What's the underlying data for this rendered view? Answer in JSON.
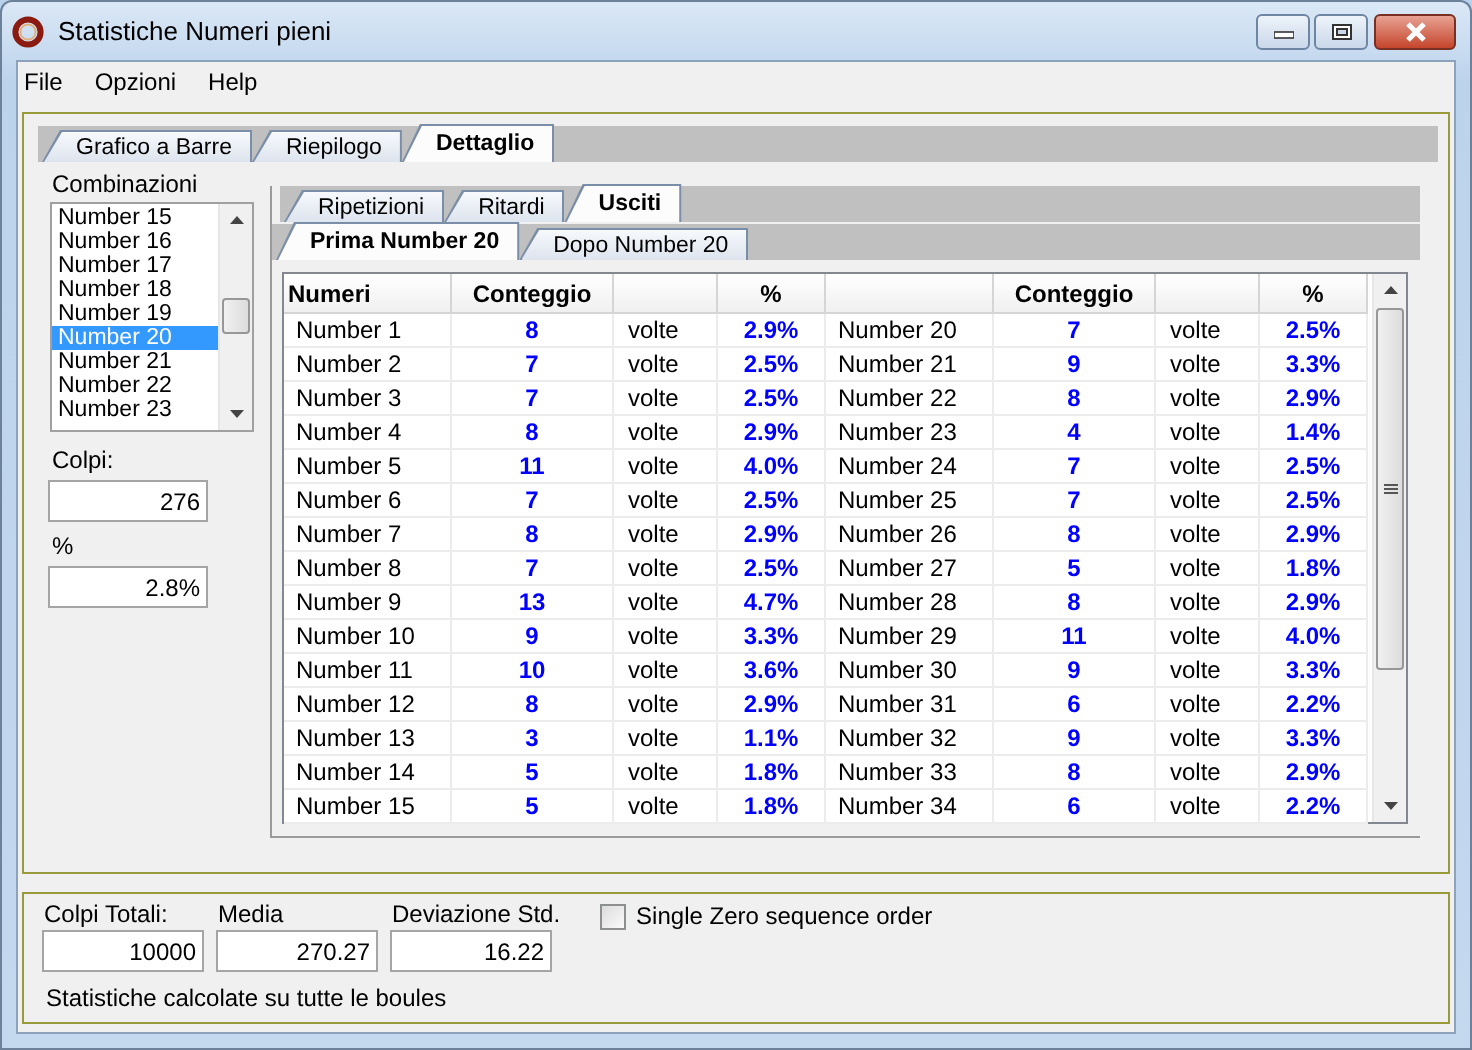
{
  "window": {
    "title": "Statistiche Numeri pieni"
  },
  "menu": [
    "File",
    "Opzioni",
    "Help"
  ],
  "tabs": [
    {
      "label": "Grafico a Barre",
      "selected": false
    },
    {
      "label": "Riepilogo",
      "selected": false
    },
    {
      "label": "Dettaglio",
      "selected": true
    }
  ],
  "combinazioni": {
    "label": "Combinazioni",
    "items": [
      {
        "label": "Number 15",
        "selected": false
      },
      {
        "label": "Number 16",
        "selected": false
      },
      {
        "label": "Number 17",
        "selected": false
      },
      {
        "label": "Number 18",
        "selected": false
      },
      {
        "label": "Number 19",
        "selected": false
      },
      {
        "label": "Number 20",
        "selected": true
      },
      {
        "label": "Number 21",
        "selected": false
      },
      {
        "label": "Number 22",
        "selected": false
      },
      {
        "label": "Number 23",
        "selected": false
      }
    ]
  },
  "colpi": {
    "label": "Colpi:",
    "value": "276"
  },
  "percent": {
    "label": "%",
    "value": "2.8%"
  },
  "sub_tabs": [
    {
      "label": "Ripetizioni",
      "selected": false
    },
    {
      "label": "Ritardi",
      "selected": false
    },
    {
      "label": "Usciti",
      "selected": true
    }
  ],
  "section_tabs": [
    {
      "label": "Prima Number 20",
      "selected": true
    },
    {
      "label": "Dopo Number 20",
      "selected": false
    }
  ],
  "table": {
    "columns": [
      {
        "kind": "name",
        "label": "Numeri"
      },
      {
        "kind": "count",
        "label": "Conteggio"
      },
      {
        "kind": "unit"
      },
      {
        "kind": "percent",
        "label": "%"
      },
      {
        "kind": "name"
      },
      {
        "kind": "count",
        "label": "Conteggio"
      },
      {
        "kind": "unit"
      },
      {
        "kind": "percent",
        "label": "%"
      }
    ],
    "rows": [
      [
        "Number 1",
        "8",
        "volte",
        "2.9%",
        "Number 20",
        "7",
        "volte",
        "2.5%"
      ],
      [
        "Number 2",
        "7",
        "volte",
        "2.5%",
        "Number 21",
        "9",
        "volte",
        "3.3%"
      ],
      [
        "Number 3",
        "7",
        "volte",
        "2.5%",
        "Number 22",
        "8",
        "volte",
        "2.9%"
      ],
      [
        "Number 4",
        "8",
        "volte",
        "2.9%",
        "Number 23",
        "4",
        "volte",
        "1.4%"
      ],
      [
        "Number 5",
        "11",
        "volte",
        "4.0%",
        "Number 24",
        "7",
        "volte",
        "2.5%"
      ],
      [
        "Number 6",
        "7",
        "volte",
        "2.5%",
        "Number 25",
        "7",
        "volte",
        "2.5%"
      ],
      [
        "Number 7",
        "8",
        "volte",
        "2.9%",
        "Number 26",
        "8",
        "volte",
        "2.9%"
      ],
      [
        "Number 8",
        "7",
        "volte",
        "2.5%",
        "Number 27",
        "5",
        "volte",
        "1.8%"
      ],
      [
        "Number 9",
        "13",
        "volte",
        "4.7%",
        "Number 28",
        "8",
        "volte",
        "2.9%"
      ],
      [
        "Number 10",
        "9",
        "volte",
        "3.3%",
        "Number 29",
        "11",
        "volte",
        "4.0%"
      ],
      [
        "Number 11",
        "10",
        "volte",
        "3.6%",
        "Number 30",
        "9",
        "volte",
        "3.3%"
      ],
      [
        "Number 12",
        "8",
        "volte",
        "2.9%",
        "Number 31",
        "6",
        "volte",
        "2.2%"
      ],
      [
        "Number 13",
        "3",
        "volte",
        "1.1%",
        "Number 32",
        "9",
        "volte",
        "3.3%"
      ],
      [
        "Number 14",
        "5",
        "volte",
        "1.8%",
        "Number 33",
        "8",
        "volte",
        "2.9%"
      ],
      [
        "Number 15",
        "5",
        "volte",
        "1.8%",
        "Number 34",
        "6",
        "volte",
        "2.2%"
      ]
    ]
  },
  "summary": {
    "fields": [
      {
        "label": "Colpi Totali:",
        "value": "10000"
      },
      {
        "label": "Media",
        "value": "270.27"
      },
      {
        "label": "Deviazione Std.",
        "value": "16.22"
      }
    ],
    "checkbox": {
      "label": "Single Zero sequence order",
      "checked": false
    },
    "note": "Statistiche calcolate su tutte le boules"
  }
}
